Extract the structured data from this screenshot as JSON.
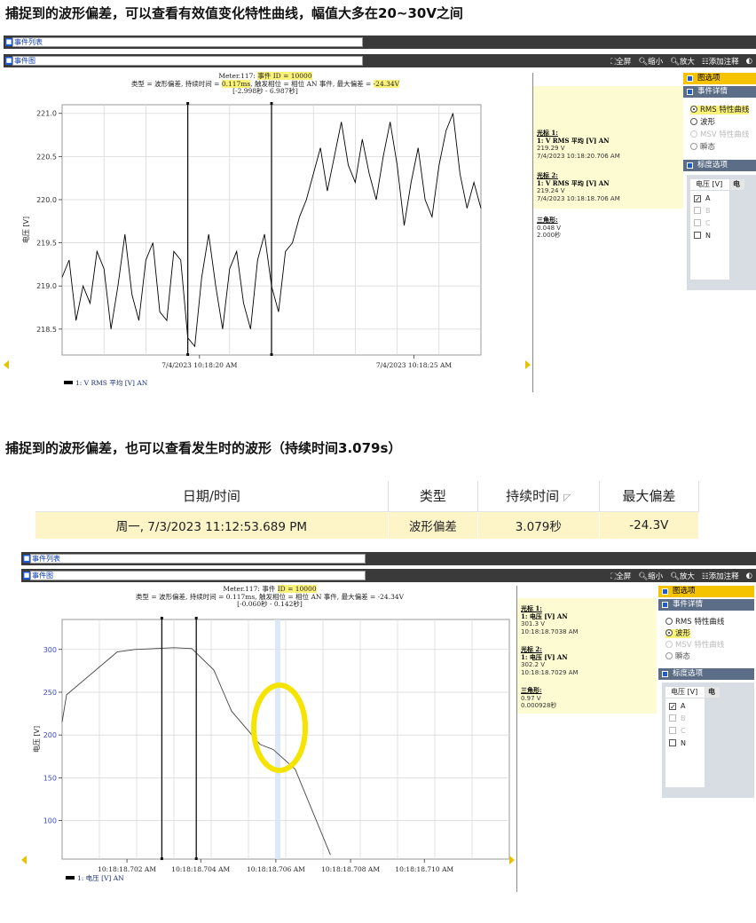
{
  "headings": {
    "first": "捕捉到的波形偏差，可以查看有效值变化特性曲线，幅值大多在20~30V之间",
    "second": "捕捉到的波形偏差，也可以查看发生时的波形（持续时间3.079s）"
  },
  "toolbar": {
    "event_list": "事件列表",
    "event_graph": "事件图",
    "fullscreen": "全屏",
    "zoom_out": "缩小",
    "zoom_in": "放大",
    "add_note": "添加注释"
  },
  "chart1": {
    "header_line1_prefix": "Meter.117: ",
    "header_line1_hl": "事件 ID = 10000",
    "header_line2_a": "类型 = 波形偏差, 持续时间 = ",
    "header_line2_hl1": "0.117ms",
    "header_line2_b": ", 触发相位 = 相位 AN 事件, 最大偏差 = ",
    "header_line2_hl2": "-24.34V",
    "header_line3": "[-2.998秒 - 6.987秒]",
    "ylabel": "电压 [V]",
    "legend": "1: V RMS 平均 [V] AN",
    "cursor1_title": "光标 1:",
    "cursor1_ch": "1: V RMS 平均 [V] AN",
    "cursor1_val": "219.29 V",
    "cursor1_time": "7/4/2023 10:18:20.706 AM",
    "cursor2_title": "光标 2:",
    "cursor2_ch": "1: V RMS 平均 [V] AN",
    "cursor2_val": "219.24 V",
    "cursor2_time": "7/4/2023 10:18:18.706 AM",
    "delta_title": "三角形:",
    "delta_val": "0.048 V",
    "delta_time": "2.000秒"
  },
  "chart2": {
    "header_line1_prefix": "Meter.117: 事件 ",
    "header_line1_hl": "ID = 10000",
    "header_line2": "类型 = 波形偏差, 持续时间 = 0.117ms, 触发相位 = 相位 AN 事件, 最大偏差 = -24.34V",
    "header_line3": "[-0.060秒 - 0.142秒]",
    "ylabel": "电压 [V]",
    "legend": "1: 电压 [V] AN",
    "cursor1_title": "光标 1:",
    "cursor1_ch": "1: 电压 [V] AN",
    "cursor1_val": "301.3 V",
    "cursor1_time": "10:18:18.7038 AM",
    "cursor2_title": "光标 2:",
    "cursor2_ch": "1: 电压 [V] AN",
    "cursor2_val": "302.2 V",
    "cursor2_time": "10:18:18.7029 AM",
    "delta_title": "三角形:",
    "delta_val": "0.97 V",
    "delta_time": "0.000928秒"
  },
  "options": {
    "graph_options": "图选项",
    "event_details": "事件详情",
    "rms_curve": "RMS 特性曲线",
    "waveform": "波形",
    "msv_curve": "MSV 特性曲线",
    "transient": "瞬态",
    "scale_options": "标度选项",
    "voltage_col": "电压 [V]",
    "second_col": "电",
    "phase_a": "A",
    "phase_b": "B",
    "phase_c": "C",
    "phase_n": "N"
  },
  "table": {
    "headers": [
      "日期/时间",
      "类型",
      "持续时间",
      "最大偏差"
    ],
    "row": [
      "周一, 7/3/2023 11:12:53.689 PM",
      "波形偏差",
      "3.079秒",
      "-24.3V"
    ]
  },
  "chart_data": [
    {
      "type": "line",
      "ylabel": "电压 [V]",
      "ylim": [
        218.2,
        221.1
      ],
      "yticks": [
        "218.5",
        "219.0",
        "219.5",
        "220.0",
        "220.5",
        "221.0"
      ],
      "xticks": [
        "7/4/2023 10:18:20 AM",
        "7/4/2023 10:18:25 AM"
      ],
      "series": [
        {
          "name": "1: V RMS 平均 [V] AN",
          "color": "#000000",
          "x": [
            0,
            1,
            2,
            3,
            4,
            5,
            6,
            7,
            8,
            9,
            10,
            11,
            12,
            13,
            14,
            15,
            16,
            17,
            18,
            19,
            20,
            21,
            22,
            23,
            24,
            25,
            26,
            27,
            28,
            29,
            30,
            31,
            32,
            33,
            34,
            35,
            36,
            37,
            38,
            39,
            40,
            41,
            42,
            43,
            44,
            45,
            46,
            47,
            48,
            49,
            50,
            51,
            52,
            53,
            54,
            55,
            56,
            57,
            58,
            59,
            60
          ],
          "values": [
            219.1,
            219.3,
            218.6,
            219.0,
            218.8,
            219.4,
            219.2,
            218.5,
            219.0,
            219.6,
            218.9,
            218.6,
            219.3,
            219.5,
            218.7,
            218.6,
            219.4,
            219.3,
            218.4,
            218.3,
            219.1,
            219.6,
            219.0,
            218.5,
            219.2,
            219.4,
            218.8,
            218.5,
            219.3,
            219.6,
            219.0,
            218.7,
            219.4,
            219.5,
            219.8,
            220.0,
            220.3,
            220.6,
            220.1,
            220.5,
            220.9,
            220.4,
            220.2,
            220.7,
            220.3,
            220.0,
            220.5,
            220.9,
            220.4,
            219.7,
            220.2,
            220.6,
            220.0,
            219.8,
            220.4,
            220.8,
            221.0,
            220.3,
            219.9,
            220.2,
            219.9
          ],
          "markers": "none"
        }
      ],
      "cursors": [
        "7/4/2023 10:18:18.706 AM",
        "7/4/2023 10:18:20.706 AM"
      ],
      "grid": true
    },
    {
      "type": "line",
      "ylabel": "电压 [V]",
      "ylim": [
        55,
        335
      ],
      "yticks": [
        "100",
        "150",
        "200",
        "250",
        "300"
      ],
      "xticks": [
        "10:18:18.702 AM",
        "10:18:18.704 AM",
        "10:18:18.706 AM",
        "10:18:18.708 AM",
        "10:18:18.710 AM"
      ],
      "series": [
        {
          "name": "1: 电压 [V] AN",
          "color": "#444444",
          "x": [
            10.18187,
            10.181872,
            10.181895,
            10.181903,
            10.181921,
            10.181929,
            10.181939,
            10.181947,
            10.181954,
            10.18196,
            10.181966,
            10.181976,
            10.181992
          ],
          "values": [
            215,
            247,
            297,
            300,
            302,
            301,
            276,
            228,
            207,
            189,
            183,
            160,
            60
          ],
          "markers": "none"
        }
      ],
      "cursors": [
        "10:18:18.7029 AM",
        "10:18:18.7038 AM"
      ],
      "annotation": "circle",
      "grid": true
    }
  ]
}
